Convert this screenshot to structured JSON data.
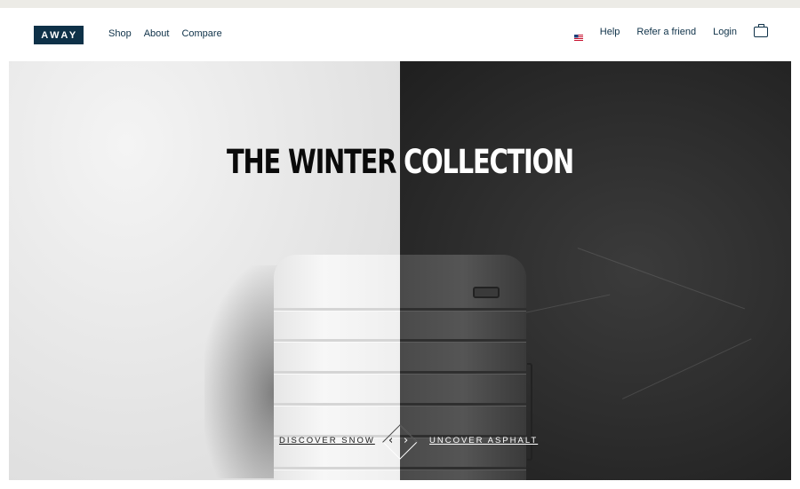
{
  "header": {
    "logo_text": "AWAY",
    "nav_left": [
      {
        "label": "Shop"
      },
      {
        "label": "About"
      },
      {
        "label": "Compare"
      }
    ],
    "nav_right": {
      "flag_icon": "us-flag-icon",
      "help": "Help",
      "refer": "Refer a friend",
      "login": "Login",
      "bag_icon": "shopping-bag-icon"
    }
  },
  "hero": {
    "title_part1": "THE WINTER ",
    "title_part2": "COLLECTION",
    "cta_left": "DISCOVER SNOW",
    "cta_right": "UNCOVER ASPHALT",
    "arrow_left": "‹",
    "arrow_right": "›",
    "colors": {
      "snow": "#ececec",
      "asphalt": "#2d2d2d",
      "brand": "#0e3148"
    }
  }
}
